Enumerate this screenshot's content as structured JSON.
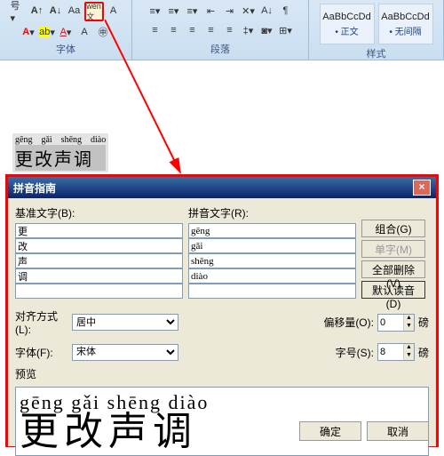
{
  "ribbon": {
    "group_font": "字体",
    "group_para": "段落",
    "group_style": "样式",
    "style1_prev": "AaBbCcDd",
    "style1_name": "• 正文",
    "style2_prev": "AaBbCcDd",
    "style2_name": "• 无间隔"
  },
  "doc": {
    "py": [
      "gēng",
      "gǎi",
      "shēng",
      "diào"
    ],
    "han": "更改声调"
  },
  "dlg": {
    "title": "拼音指南",
    "lbl_base": "基准文字(B):",
    "lbl_ruby": "拼音文字(R):",
    "base": [
      "更",
      "改",
      "声",
      "调",
      ""
    ],
    "ruby": [
      "gēng",
      "gǎi",
      "shēng",
      "diào",
      ""
    ],
    "btn_combine": "组合(G)",
    "btn_single": "单字(M)",
    "btn_clear": "全部删除(V)",
    "btn_default": "默认读音(D)",
    "lbl_align": "对齐方式(L):",
    "val_align": "居中",
    "lbl_offset": "偏移量(O):",
    "val_offset": "0",
    "unit_pt": "磅",
    "lbl_font": "字体(F):",
    "val_font": "宋体",
    "lbl_size": "字号(S):",
    "val_size": "8",
    "lbl_preview": "预览",
    "prev_py": "gēng  gǎi  shēng diào",
    "prev_han": "更改声调",
    "ok": "确定",
    "cancel": "取消",
    "close": "×"
  }
}
